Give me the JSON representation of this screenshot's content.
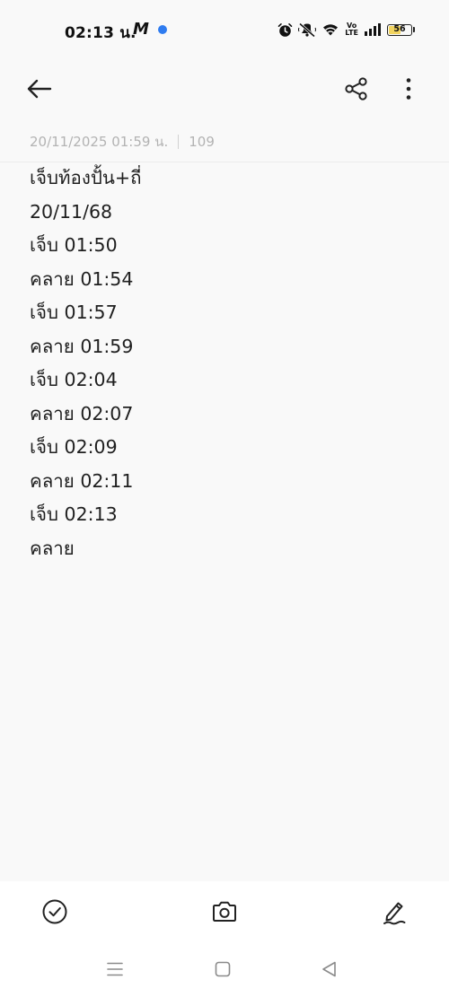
{
  "status_bar": {
    "time": "02:13 น.",
    "app_indicator": "M",
    "battery_level": "56",
    "icons": [
      "alarm-icon",
      "mute-icon",
      "wifi-icon",
      "volte-icon",
      "signal-icon",
      "battery-icon"
    ],
    "volte_line1": "Vo",
    "volte_line2": "LTE"
  },
  "app_bar": {
    "icons": [
      "back-arrow-icon",
      "share-icon",
      "more-vert-icon"
    ]
  },
  "note": {
    "timestamp": "20/11/2025 01:59 น.",
    "char_count": "109",
    "lines": [
      "เจ็บท้องปั้น+ถี่",
      "20/11/68",
      "เจ็บ 01:50",
      "คลาย 01:54",
      "เจ็บ 01:57",
      "คลาย 01:59",
      "เจ็บ 02:04",
      "คลาย 02:07",
      "เจ็บ 02:09",
      "คลาย 02:11",
      "เจ็บ 02:13",
      "คลาย"
    ]
  },
  "toolbar": {
    "icons": [
      "checklist-icon",
      "camera-icon",
      "handwriting-icon"
    ]
  },
  "system_nav": {
    "icons": [
      "recents-icon",
      "home-icon",
      "back-triangle-icon"
    ]
  },
  "colors": {
    "background": "#f9f9f9",
    "text": "#1f1f1f",
    "meta_text": "#b3b3b3",
    "battery_fill": "#f2d45f",
    "indicator_dot": "#2f7cf0"
  }
}
